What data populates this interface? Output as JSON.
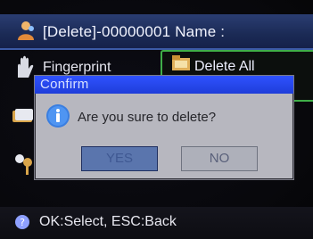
{
  "header": {
    "title": "[Delete]-00000001 Name :"
  },
  "menu": {
    "fingerprint_label": "Fingerprint",
    "delete_all_label": "Delete All"
  },
  "dialog": {
    "title": "Confirm",
    "message": "Are you sure to delete?",
    "yes_label": "YES",
    "no_label": "NO"
  },
  "footer": {
    "hint": "OK:Select, ESC:Back"
  },
  "icons": {
    "header": "user-icon",
    "fingerprint": "hand-icon",
    "delete_all": "folder-icon",
    "side_1": "card-icon",
    "side_2": "key-icon",
    "dialog": "info-icon",
    "footer": "help-icon"
  },
  "colors": {
    "title_bar": "#1b2a55",
    "dialog_title": "#1e3dd9",
    "selection_border": "#3fae48",
    "dialog_body": "#b7b7bf"
  }
}
